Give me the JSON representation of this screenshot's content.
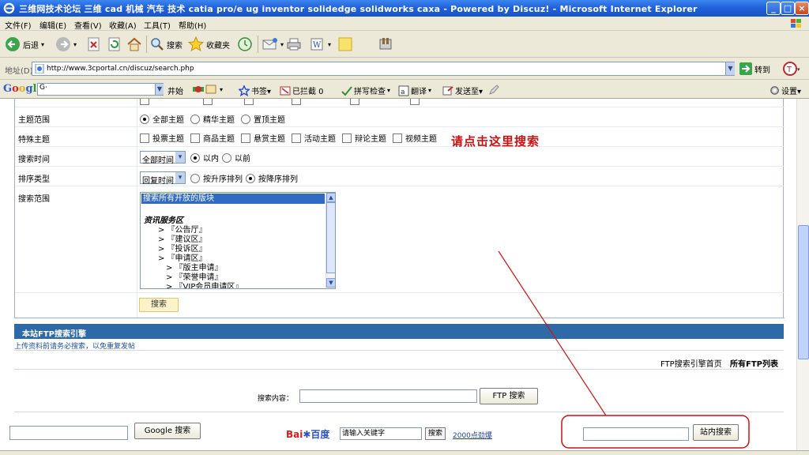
{
  "window": {
    "title": "三维网技术论坛 三维 cad 机械 汽车 技术 catia pro/e ug inventor solidedge solidworks caxa - Powered by Discuz! - Microsoft Internet Explorer",
    "minimize": "_",
    "maximize": "□",
    "close": "×"
  },
  "menu": [
    "文件(F)",
    "编辑(E)",
    "查看(V)",
    "收藏(A)",
    "工具(T)",
    "帮助(H)"
  ],
  "toolbar": {
    "back": "后退",
    "search": "搜索",
    "favorites": "收藏夹"
  },
  "address": {
    "label": "地址(D)",
    "url": "http://www.3cportal.cn/discuz/search.php",
    "go": "转到"
  },
  "google_bar": {
    "logo": "Google",
    "search_value": "G·",
    "items": [
      "井始",
      "书签▾",
      "已拦截 0",
      "拼写检查",
      "翻译",
      "发送至▾",
      "设置▾"
    ]
  },
  "form": {
    "rows": [
      {
        "label": "主题范围",
        "options": [
          {
            "text": "全部主题",
            "type": "radio",
            "checked": true
          },
          {
            "text": "精华主题",
            "type": "radio",
            "checked": false
          },
          {
            "text": "置顶主题",
            "type": "radio",
            "checked": false
          }
        ]
      },
      {
        "label": "特殊主题",
        "options": [
          {
            "text": "投票主题",
            "type": "checkbox"
          },
          {
            "text": "商品主题",
            "type": "checkbox"
          },
          {
            "text": "悬赏主题",
            "type": "checkbox"
          },
          {
            "text": "活动主题",
            "type": "checkbox"
          },
          {
            "text": "辩论主题",
            "type": "checkbox"
          },
          {
            "text": "视频主题",
            "type": "checkbox"
          }
        ]
      },
      {
        "label": "搜索时间",
        "select": "全部时间",
        "options": [
          {
            "text": "以内",
            "type": "radio",
            "checked": true
          },
          {
            "text": "以前",
            "type": "radio",
            "checked": false
          }
        ]
      },
      {
        "label": "排序类型",
        "select": "回复时间",
        "options": [
          {
            "text": "按升序排列",
            "type": "radio",
            "checked": false
          },
          {
            "text": "按降序排列",
            "type": "radio",
            "checked": true
          }
        ]
      },
      {
        "label": "搜索范围"
      }
    ],
    "scope_list": {
      "selected": "搜索所有开放的版块",
      "items": [
        "",
        "资讯服务区",
        "> 『公告厅』",
        "> 『建议区』",
        "> 『投诉区』",
        "> 『申请区』",
        "> 『版主申请』",
        "> 『荣誉申请』",
        "> 『VIP会员申请区』"
      ]
    },
    "submit": "搜索"
  },
  "ftp": {
    "header": "本站FTP搜索引擎",
    "note": "上传资料前请务必搜索，以免重复发帖",
    "link_home": "FTP搜索引擎首页",
    "link_list": "所有FTP列表",
    "label": "搜索内容：",
    "button": "FTP 搜索"
  },
  "bottom": {
    "google_button": "Google 搜索",
    "baidu_logo_bai": "Bai",
    "baidu_logo_du": "百度",
    "baidu_input": "请输入关键字",
    "baidu_button": "搜索",
    "baidu_link": "2000点劲爆",
    "site_button": "站内搜索"
  },
  "annotation": {
    "text": "请点击这里搜索",
    "color": "#d01010"
  }
}
